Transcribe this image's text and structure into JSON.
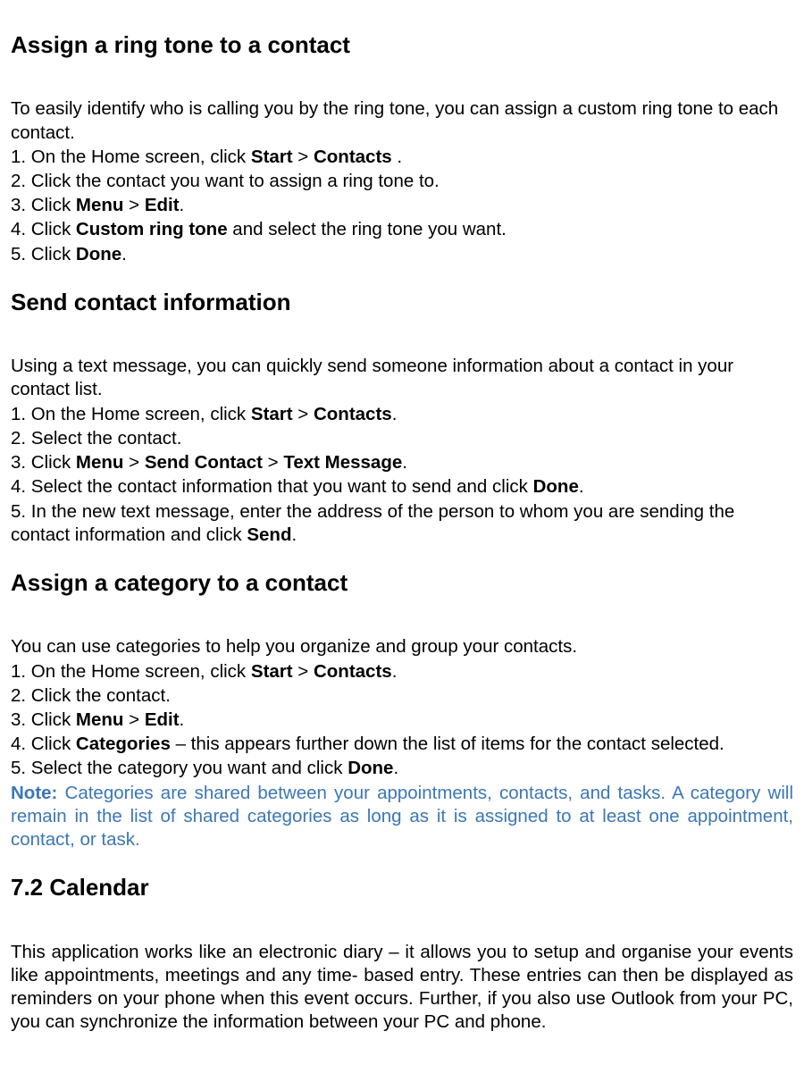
{
  "sections": [
    {
      "heading": "Assign a ring tone to a contact",
      "intro": "To easily identify who is calling you by the ring tone, you can assign a custom ring tone to each contact.",
      "step1_pre": "1. On the Home screen, click ",
      "step1_b1": "Start",
      "step1_mid": " > ",
      "step1_b2": "Contacts",
      "step1_post": " .",
      "step2": "2. Click the contact you want to assign a ring tone to.",
      "step3_pre": "3. Click ",
      "step3_b1": "Menu",
      "step3_mid": " > ",
      "step3_b2": "Edit",
      "step3_post": ".",
      "step4_pre": "4. Click ",
      "step4_b1": "Custom ring tone",
      "step4_post": " and select the ring tone you want.",
      "step5_pre": "5. Click ",
      "step5_b1": "Done",
      "step5_post": "."
    },
    {
      "heading": "Send contact information",
      "intro": "Using a text message, you can quickly send someone information about a contact in your contact list.",
      "step1_pre": "1. On the Home screen, click ",
      "step1_b1": "Start",
      "step1_mid": " > ",
      "step1_b2": "Contacts",
      "step1_post": ".",
      "step2": "2. Select the contact.",
      "step3_pre": "3. Click ",
      "step3_b1": "Menu",
      "step3_mid1": " > ",
      "step3_b2": "Send Contact",
      "step3_mid2": " > ",
      "step3_b3": "Text Message",
      "step3_post": ".",
      "step4_pre": "4. Select the contact information that you want to send and click ",
      "step4_b1": "Done",
      "step4_post": ".",
      "step5_pre": "5. In the new text message, enter the address of the person to whom you are sending the contact information and click ",
      "step5_b1": "Send",
      "step5_post": "."
    },
    {
      "heading": "Assign a category to a contact",
      "intro": "You can use categories to help you organize and group your contacts.",
      "step1_pre": "1. On the Home screen, click ",
      "step1_b1": "Start",
      "step1_mid": " > ",
      "step1_b2": "Contacts",
      "step1_post": ".",
      "step2": "2. Click the contact.",
      "step3_pre": "3. Click ",
      "step3_b1": "Menu",
      "step3_mid": " > ",
      "step3_b2": "Edit",
      "step3_post": ".",
      "step4_pre": "4. Click ",
      "step4_b1": "Categories",
      "step4_post": " – this appears further down the list of items for the contact selected.",
      "step5_pre": "5. Select the category you want and click ",
      "step5_b1": "Done",
      "step5_post": ".",
      "note_label": "Note:",
      "note_text": " Categories are shared between your appointments, contacts, and tasks. A category will remain in the list of shared categories as long as it is assigned to at least one appointment, contact, or task."
    },
    {
      "heading": "7.2 Calendar",
      "intro": "This application works like an electronic diary – it allows you to setup and organise your events like appointments, meetings and any time- based entry. These entries can then be displayed as reminders on your phone when this event occurs. Further, if you also use Outlook from your PC, you can synchronize the information between your PC and phone."
    }
  ]
}
